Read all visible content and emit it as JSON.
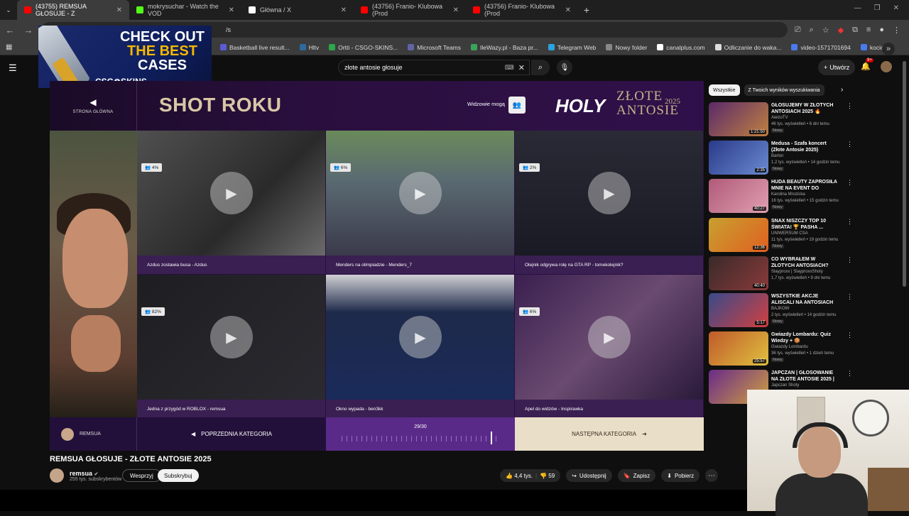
{
  "browser": {
    "tabs": [
      {
        "title": "(43755) REMSUA GŁOSUJE - Z",
        "favicon_color": "#ff0000"
      },
      {
        "title": "mokrysuchar - Watch the VOD",
        "favicon_color": "#53fc18"
      },
      {
        "title": "Główna / X",
        "favicon_color": "#ffffff"
      },
      {
        "title": "(43756) Franio- Klubowa (Prod",
        "favicon_color": "#ff0000"
      },
      {
        "title": "(43756) Franio- Klubowa (Prod",
        "favicon_color": "#ff0000"
      }
    ],
    "url": "/s",
    "bookmarks": [
      {
        "label": "Basketball live result...",
        "color": "#5b5bd6"
      },
      {
        "label": "Hltv",
        "color": "#2d6a9f"
      },
      {
        "label": "Ortti - CSGO-SKINS...",
        "color": "#2aa84a"
      },
      {
        "label": "Microsoft Teams",
        "color": "#6264a7"
      },
      {
        "label": "IleWazy.pl - Baza pr...",
        "color": "#3aa35a"
      },
      {
        "label": "Telegram Web",
        "color": "#2aa3e0"
      },
      {
        "label": "Nowy folder",
        "color": "#888888"
      },
      {
        "label": "canalplus.com",
        "color": "#ffffff"
      },
      {
        "label": "Odliczanie do waka...",
        "color": "#dddddd"
      },
      {
        "label": "video-1571701694",
        "color": "#4a7af0"
      },
      {
        "label": "kocica",
        "color": "#4a7af0"
      }
    ]
  },
  "ad": {
    "line1": "CHECK OUT",
    "line2": "THE BEST",
    "line3": "CASES",
    "brand": "CSG⊗SKINS"
  },
  "youtube": {
    "search_value": "złote antosie głosuje",
    "create_label": "Utwórz",
    "notif_count": "9+"
  },
  "player": {
    "home_label": "STRONA GŁÓWNA",
    "heading": "SHOT ROKU",
    "viewers_label": "Widzowie mogą",
    "brand_holy": "HOLY",
    "brand_event": "ZŁOTE ANTOSIE",
    "brand_year": "2025",
    "cells": [
      {
        "caption": "Azdus zostawia busa - Azdus",
        "pct": "4%",
        "bg": "#3a3a3a"
      },
      {
        "caption": "Menders na olimpiadzie - Menders_7",
        "pct": "6%",
        "bg": "#5a6a52"
      },
      {
        "caption": "Olejnik odgrywa rolę na GTA RP - tomekolejnik?",
        "pct": "2%",
        "bg": "#2a2a36"
      },
      {
        "caption": "Jedna z przygód w ROBLOX - remsua",
        "pct": "82%",
        "bg": "#1e1e22"
      },
      {
        "caption": "Okno wypada - ben3kk",
        "pct": "",
        "bg": "#1e2a4a"
      },
      {
        "caption": "Apel do widzów - Inspirawka",
        "pct": "6%",
        "bg": "#4a3050"
      }
    ],
    "streamer_name": "REMSUA",
    "prev_label": "POPRZEDNIA KATEGORIA",
    "next_label": "NASTĘPNA KATEGORIA",
    "progress_text": "29/30"
  },
  "video": {
    "title": "REMSUA GŁOSUJE - ZŁOTE ANTOSIE 2025",
    "channel": "remsua",
    "subscribers": "255 tys. subskrybentów",
    "support_label": "Wesprzyj",
    "subscribe_label": "Subskrybuj",
    "likes": "4,4 tys.",
    "dislikes": "59",
    "share_label": "Udostępnij",
    "save_label": "Zapisz",
    "download_label": "Pobierz"
  },
  "sidebar": {
    "chips": [
      "Wszystkie",
      "Z Twoich wyników wyszukiwania"
    ],
    "items": [
      {
        "title": "GŁOSUJEMY W ZŁOTYCH ANTOSIACH 2025 🔥",
        "channel": "AwizoTV",
        "meta": "46 tys. wyświetleń • 6 dni temu",
        "duration": "1:21:50",
        "badge": "Nowy",
        "color": "#5a2a6a"
      },
      {
        "title": "Medusa - Szafa koncert (Złote Antosie 2025)",
        "channel": "Barlon",
        "meta": "1,2 tys. wyświetleń • 14 godzin temu",
        "duration": "2:35",
        "badge": "Nowy",
        "color": "#2a3a8a"
      },
      {
        "title": "HUDA BEAUTY ZAPROSIŁA MNIE NA EVENT DO DUBAJU...",
        "channel": "Karolina Mrozicka",
        "meta": "16 tys. wyświetleń • 15 godzin temu",
        "duration": "40:27",
        "badge": "Nowy",
        "color": "#b05a7a"
      },
      {
        "title": "SNAX NISZCZY TOP 10 ŚWIATA! 🏆 PASHA ...",
        "channel": "UNIWERSUM CSA",
        "meta": "11 tys. wyświetleń • 19 godzin temu",
        "duration": "12:36",
        "badge": "Nowy",
        "color": "#c8a030"
      },
      {
        "title": "CO WYBRAŁEM W ZŁOTYCH ANTOSIACH? STREAMER ROK...",
        "channel": "Slayproxx | SlayproxxShoty",
        "meta": "1,7 tys. wyświetleń • 9 dni temu",
        "duration": "40:40",
        "badge": "",
        "color": "#3a2a2a"
      },
      {
        "title": "WSZYSTKIE AKCJE ALISCALI NA ANTOSIACH",
        "channel": "BAJKOW",
        "meta": "2 tys. wyświetleń • 14 godzin temu",
        "duration": "5:17",
        "badge": "Nowy",
        "color": "#3a4a8a"
      },
      {
        "title": "Gwiazdy Lombardu: Quiz Wiedzy + 🍪",
        "channel": "Gwiazdy Lombardu",
        "meta": "36 tys. wyświetleń • 1 dzień temu",
        "duration": "25:57",
        "badge": "Nowy",
        "color": "#c05a2a"
      },
      {
        "title": "JAPCZAN | GŁOSOWANIE NA ZŁOTE ANTOSIE 2025 |",
        "channel": "Japczan Shoty",
        "meta": "",
        "duration": "",
        "badge": "",
        "color": "#6a2a8a"
      }
    ]
  }
}
